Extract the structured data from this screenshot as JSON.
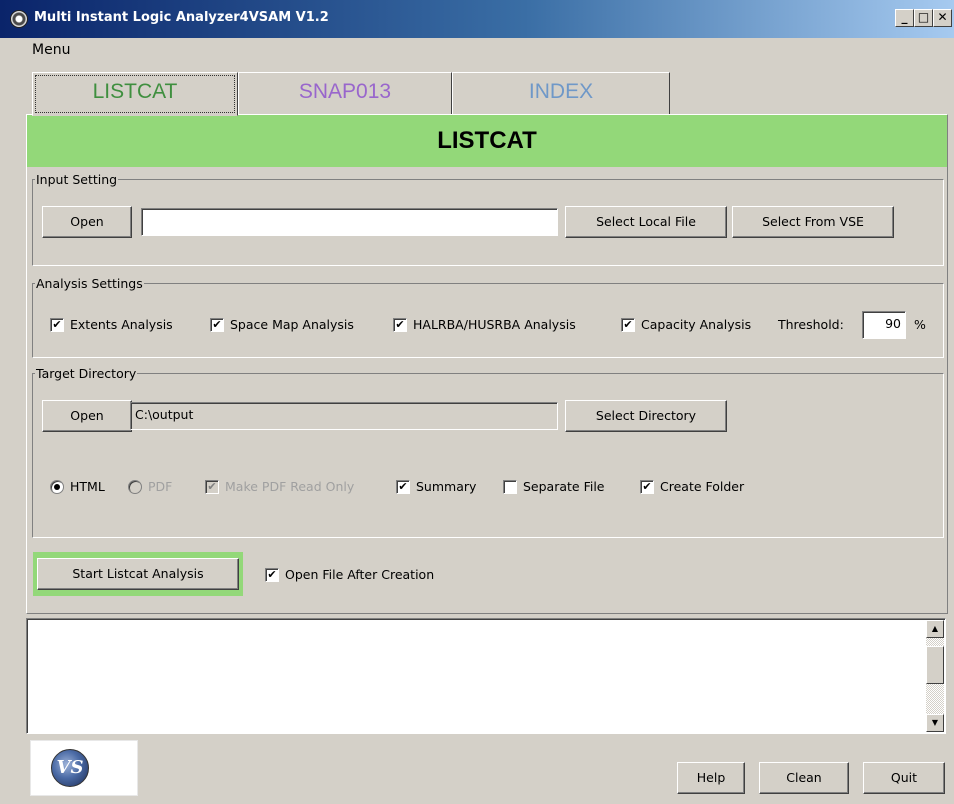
{
  "window": {
    "title": "Multi Instant Logic Analyzer4VSAM V1.2",
    "min_glyph": "_",
    "max_glyph": "□",
    "close_glyph": "✕"
  },
  "menu": {
    "label": "Menu"
  },
  "tabs": [
    {
      "label": "LISTCAT",
      "color": "#3f8f3f",
      "selected": true
    },
    {
      "label": "SNAP013",
      "color": "#9966cc",
      "selected": false
    },
    {
      "label": "INDEX",
      "color": "#6f98c8",
      "selected": false
    }
  ],
  "header": {
    "title": "LISTCAT",
    "color": "#93d879"
  },
  "input_setting": {
    "legend": "Input Setting",
    "open_label": "Open",
    "path_value": "",
    "select_local_label": "Select Local File",
    "select_vse_label": "Select From VSE"
  },
  "analysis_settings": {
    "legend": "Analysis Settings",
    "extents": {
      "label": "Extents Analysis",
      "checked": true
    },
    "space_map": {
      "label": "Space Map Analysis",
      "checked": true
    },
    "halrba": {
      "label": "HALRBA/HUSRBA Analysis",
      "checked": true
    },
    "capacity": {
      "label": "Capacity Analysis",
      "checked": true
    },
    "threshold_label": "Threshold:",
    "threshold_value": "90",
    "threshold_unit": "%"
  },
  "target_directory": {
    "legend": "Target Directory",
    "open_label": "Open",
    "path_value": "C:\\output",
    "select_dir_label": "Select Directory",
    "html": {
      "label": "HTML",
      "selected": true
    },
    "pdf": {
      "label": "PDF",
      "selected": false,
      "enabled": false
    },
    "pdf_readonly": {
      "label": "Make PDF Read Only",
      "checked": true,
      "enabled": false
    },
    "summary": {
      "label": "Summary",
      "checked": true
    },
    "separate_file": {
      "label": "Separate File",
      "checked": false
    },
    "create_folder": {
      "label": "Create Folder",
      "checked": true
    }
  },
  "actions": {
    "start_label": "Start Listcat Analysis",
    "open_after": {
      "label": "Open File After Creation",
      "checked": true
    }
  },
  "log": {
    "text": ""
  },
  "footer": {
    "logo_text": "VS",
    "help_label": "Help",
    "clean_label": "Clean",
    "quit_label": "Quit"
  },
  "glyphs": {
    "check": "✔",
    "scroll_up": "▲",
    "scroll_down": "▼"
  }
}
